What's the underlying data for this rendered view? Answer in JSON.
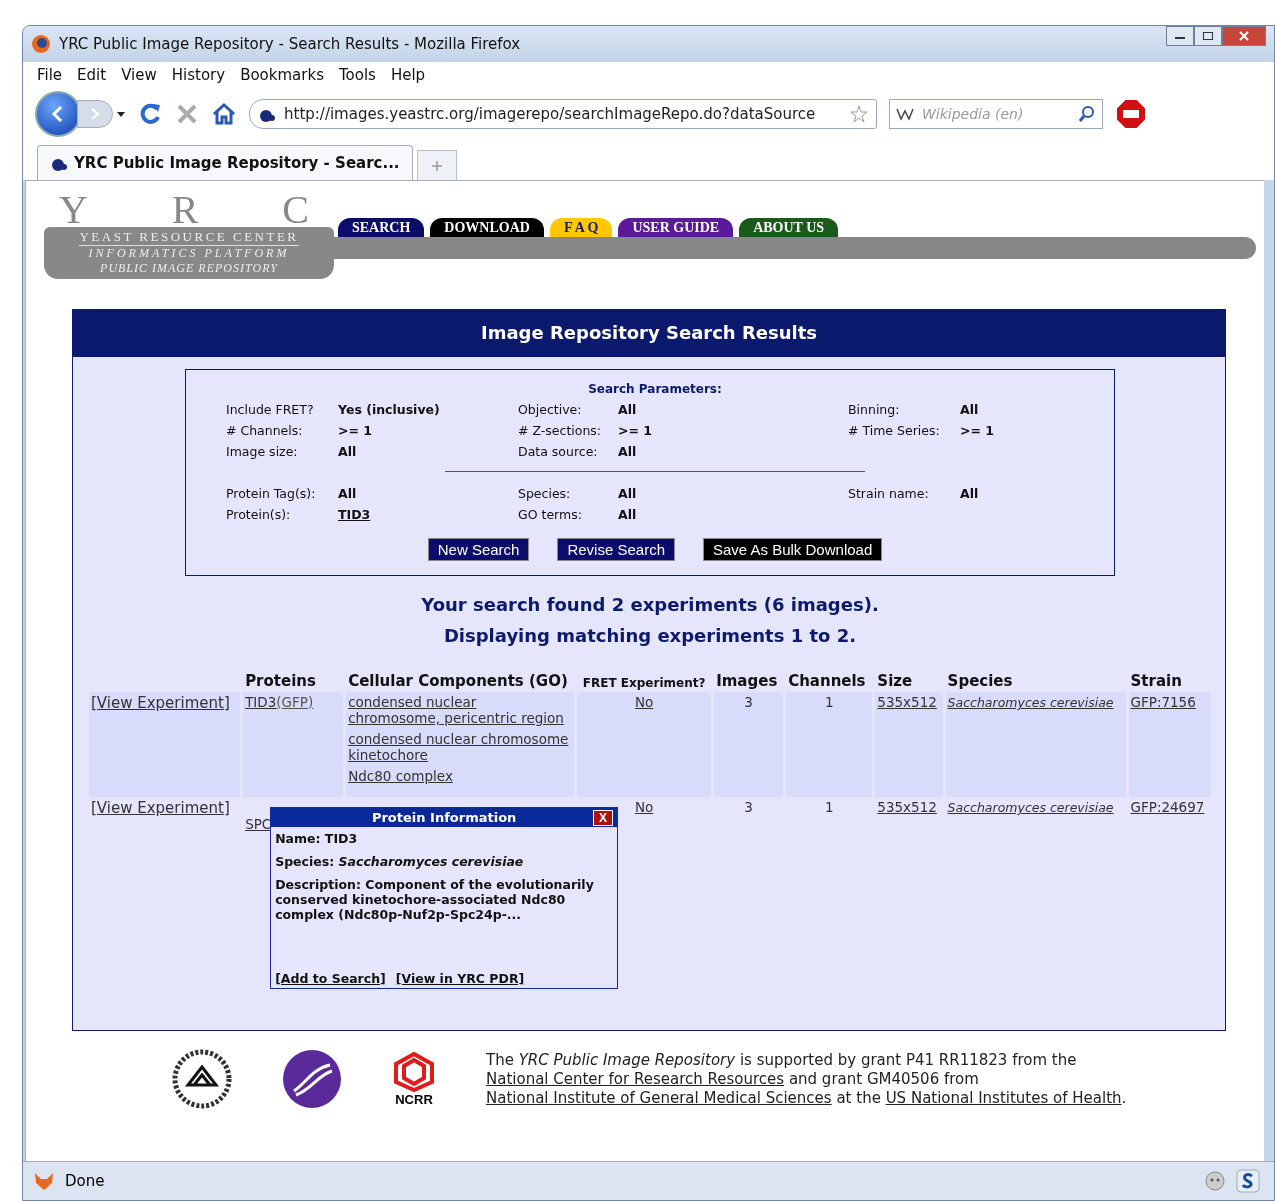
{
  "window": {
    "title": "YRC Public Image Repository - Search Results - Mozilla Firefox"
  },
  "menu": [
    "File",
    "Edit",
    "View",
    "History",
    "Bookmarks",
    "Tools",
    "Help"
  ],
  "address_bar": {
    "value": "http://images.yeastrc.org/imagerepo/searchImageRepo.do?dataSource"
  },
  "search_bar": {
    "placeholder": "Wikipedia (en)"
  },
  "tabs": [
    {
      "label": "YRC Public Image Repository - Searc...",
      "selected": true
    }
  ],
  "site": {
    "logo_letters": [
      "Y",
      "R",
      "C"
    ],
    "logo_name": "YEAST RESOURCE CENTER",
    "platform": "INFORMATICS PLATFORM",
    "repository": "PUBLIC IMAGE REPOSITORY",
    "nav": [
      {
        "label": "SEARCH",
        "color": "#0c0c6a"
      },
      {
        "label": "DOWNLOAD",
        "color": "#000000"
      },
      {
        "label": "F A Q",
        "color": "#ffc800"
      },
      {
        "label": "USER GUIDE",
        "color": "#5a1a9a"
      },
      {
        "label": "ABOUT US",
        "color": "#1a5a1a"
      }
    ]
  },
  "panel": {
    "title": "Image Repository Search Results",
    "parameters": {
      "heading": "Search Parameters:",
      "groups": [
        [
          [
            {
              "label": "Include FRET?",
              "value": "Yes (inclusive)"
            },
            {
              "label": "Objective:",
              "value": "All"
            },
            {
              "label": "Binning:",
              "value": "All"
            }
          ],
          [
            {
              "label": "# Channels:",
              "value": ">= 1"
            },
            {
              "label": "# Z-sections:",
              "value": ">= 1"
            },
            {
              "label": "# Time Series:",
              "value": ">= 1"
            }
          ],
          [
            {
              "label": "Image size:",
              "value": "All"
            },
            {
              "label": "Data source:",
              "value": "All"
            }
          ]
        ],
        [
          [
            {
              "label": "Protein Tag(s):",
              "value": "All"
            },
            {
              "label": "Species:",
              "value": "All"
            },
            {
              "label": "Strain name:",
              "value": "All"
            }
          ],
          [
            {
              "label": "Protein(s):",
              "value": "TID3",
              "link": true
            },
            {
              "label": "GO terms:",
              "value": "All"
            }
          ]
        ]
      ],
      "buttons": [
        {
          "label": "New Search",
          "color": "#0c0c6a"
        },
        {
          "label": "Revise Search",
          "color": "#0c0c6a"
        },
        {
          "label": "Save As Bulk Download",
          "color": "#000000"
        }
      ]
    },
    "summary": [
      "Your search found 2 experiments (6 images).",
      "Displaying matching experiments 1 to 2."
    ],
    "table": {
      "columns": [
        "Proteins",
        "Cellular Components (GO)",
        "FRET Experiment?",
        "Images",
        "Channels",
        "Size",
        "Species",
        "Strain"
      ],
      "rows": [
        {
          "link": "[View Experiment]",
          "proteins": [
            {
              "name": "TID3",
              "tag": "(GFP)"
            }
          ],
          "components": [
            "condensed nuclear chromosome, pericentric region",
            "condensed nuclear chromosome kinetochore",
            "Ndc80 complex"
          ],
          "fret": "No",
          "images": "3",
          "channels": "1",
          "size": "535x512",
          "species": "Saccharomyces cerevisiae",
          "strain": "GFP:7156"
        },
        {
          "link": "[View Experiment]",
          "proteins": [
            {
              "name": "SPC"
            }
          ],
          "fret": "No",
          "images": "3",
          "channels": "1",
          "size": "535x512",
          "species": "Saccharomyces cerevisiae",
          "strain": "GFP:24697"
        }
      ]
    },
    "popup": {
      "title": "Protein Information",
      "close": "X",
      "name": "Name: TID3",
      "species": "Species: *Saccharomyces cerevisiae*",
      "description": "Description: Component of the evolutionarily conserved kinetochore-associated Ndc80 complex (Ndc80p-Nuf2p-Spc24p-...",
      "links": [
        "[Add to Search]",
        "[View in YRC PDR]"
      ]
    }
  },
  "footer": {
    "logo_text": "NCRR",
    "segments": [
      {
        "kind": "text",
        "text": "The *YRC Public Image Repository* is supported by grant P41 RR11823 from the "
      },
      {
        "kind": "link",
        "text": "National Center for Research Resources"
      },
      {
        "kind": "text",
        "text": " and grant GM40506 from "
      },
      {
        "kind": "link",
        "text": "National Institute of General Medical Sciences"
      },
      {
        "kind": "text",
        "text": " at the "
      },
      {
        "kind": "link",
        "text": "US National Institutes of Health"
      },
      {
        "kind": "text",
        "text": "."
      }
    ]
  },
  "status_bar": {
    "text": "Done"
  }
}
